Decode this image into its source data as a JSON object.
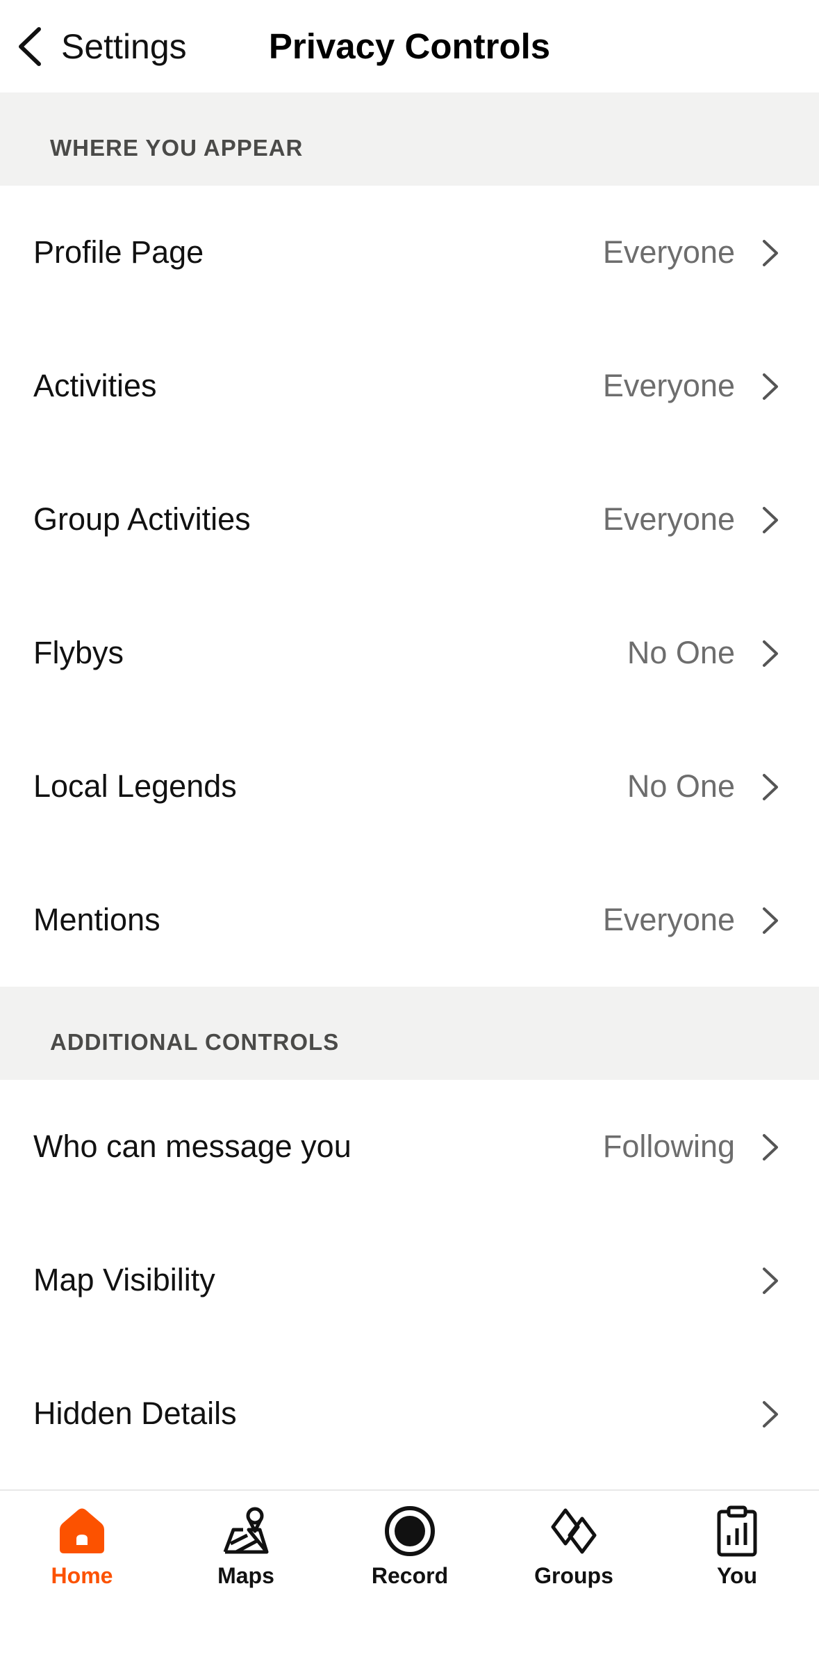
{
  "navbar": {
    "back_label": "Settings",
    "title": "Privacy Controls"
  },
  "sections": [
    {
      "header": "WHERE YOU APPEAR",
      "rows": [
        {
          "label": "Profile Page",
          "value": "Everyone"
        },
        {
          "label": "Activities",
          "value": "Everyone"
        },
        {
          "label": "Group Activities",
          "value": "Everyone"
        },
        {
          "label": "Flybys",
          "value": "No One"
        },
        {
          "label": "Local Legends",
          "value": "No One"
        },
        {
          "label": "Mentions",
          "value": "Everyone"
        }
      ]
    },
    {
      "header": "ADDITIONAL CONTROLS",
      "rows": [
        {
          "label": "Who can message you",
          "value": "Following"
        },
        {
          "label": "Map Visibility",
          "value": ""
        },
        {
          "label": "Hidden Details",
          "value": ""
        }
      ]
    }
  ],
  "tabbar": {
    "items": [
      {
        "label": "Home",
        "icon": "home-icon",
        "active": true
      },
      {
        "label": "Maps",
        "icon": "maps-icon",
        "active": false
      },
      {
        "label": "Record",
        "icon": "record-icon",
        "active": false
      },
      {
        "label": "Groups",
        "icon": "groups-icon",
        "active": false
      },
      {
        "label": "You",
        "icon": "you-icon",
        "active": false
      }
    ]
  },
  "colors": {
    "accent": "#fc5200",
    "section_bg": "#f2f2f1",
    "secondary_text": "#6d6d6d"
  }
}
